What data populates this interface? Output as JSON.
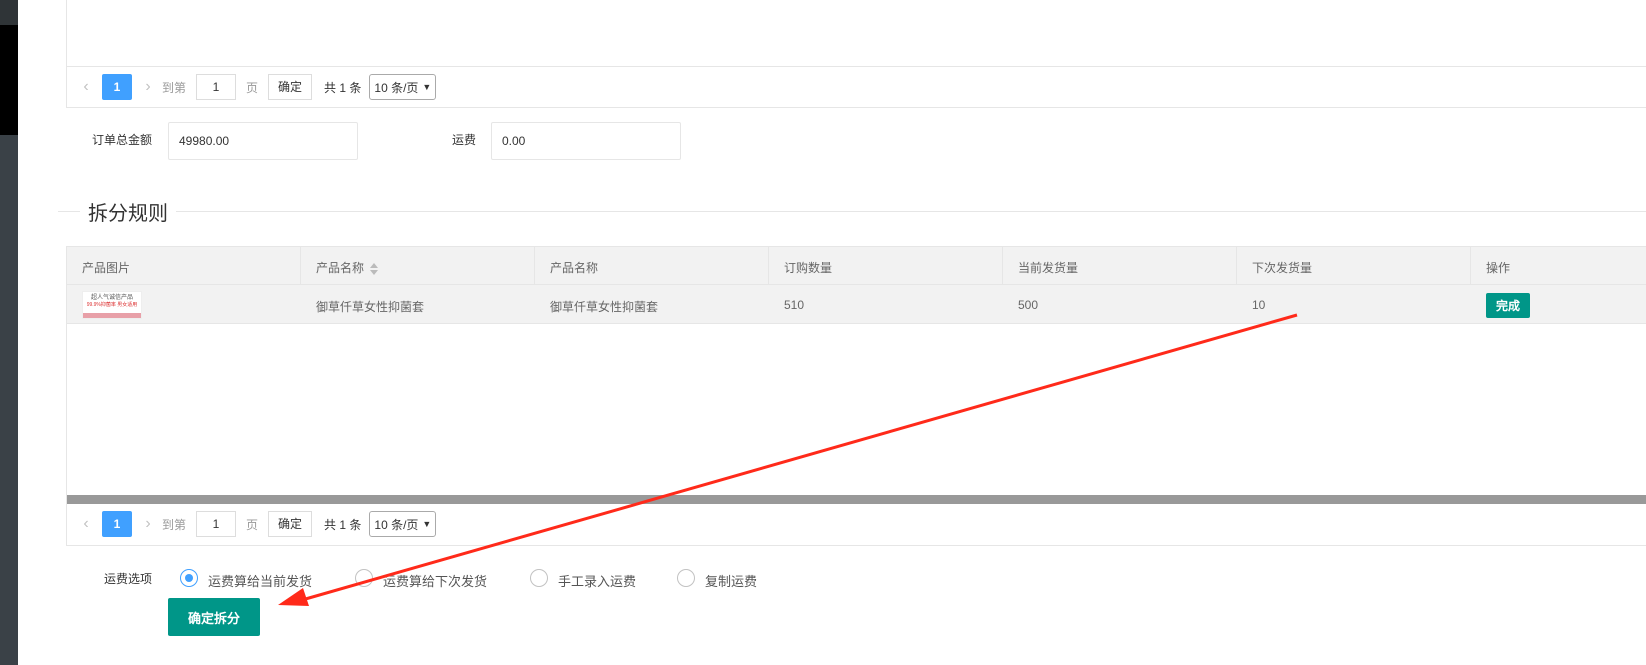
{
  "top_pager": {
    "prev_icon": "chevron-left-icon",
    "current_page": "1",
    "next_icon": "chevron-right-icon",
    "goto_label": "到第",
    "goto_value": "1",
    "page_unit": "页",
    "confirm_label": "确定",
    "total_label": "共 1 条",
    "page_size": "10 条/页"
  },
  "order": {
    "total_label": "订单总金额",
    "total_value": "49980.00",
    "shipping_label": "运费",
    "shipping_value": "0.00"
  },
  "split_rules": {
    "legend": "拆分规则",
    "columns": [
      "产品图片",
      "产品名称",
      "产品名称",
      "订购数量",
      "当前发货量",
      "下次发货量",
      "操作"
    ],
    "rows": [
      {
        "image_caption_line1": "超人气诚信产品",
        "image_caption_line2": "99.9%抑菌率 男女适用",
        "name1": "御草仟草女性抑菌套",
        "name2": "御草仟草女性抑菌套",
        "order_qty": "510",
        "current_qty": "500",
        "next_qty": "10",
        "action": "完成"
      }
    ]
  },
  "bottom_pager": {
    "current_page": "1",
    "goto_label": "到第",
    "goto_value": "1",
    "page_unit": "页",
    "confirm_label": "确定",
    "total_label": "共 1 条",
    "page_size": "10 条/页"
  },
  "shipping_options": {
    "label": "运费选项",
    "options": [
      "运费算给当前发货",
      "运费算给下次发货",
      "手工录入运费",
      "复制运费"
    ],
    "selected_index": 0
  },
  "submit_label": "确定拆分",
  "colors": {
    "accent_blue": "#40a0ff",
    "teal": "#009688",
    "annotation_red": "#ff2a1a"
  }
}
